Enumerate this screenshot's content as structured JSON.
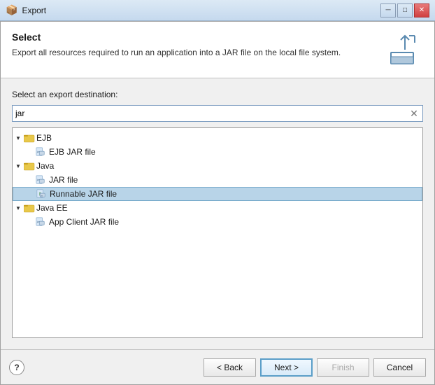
{
  "titlebar": {
    "title": "Export",
    "min_label": "─",
    "max_label": "□",
    "close_label": "✕"
  },
  "header": {
    "title": "Select",
    "description": "Export all resources required to run an application into a JAR file on the local file system.",
    "icon_label": "export-icon"
  },
  "content": {
    "label": "Select an export destination:",
    "search_value": "jar",
    "search_placeholder": "",
    "tree": [
      {
        "id": "ejb",
        "level": 0,
        "type": "folder",
        "label": "EJB",
        "expanded": true,
        "selected": false,
        "children": [
          {
            "id": "ejb-jar",
            "level": 1,
            "type": "file",
            "label": "EJB JAR file",
            "selected": false
          }
        ]
      },
      {
        "id": "java",
        "level": 0,
        "type": "folder",
        "label": "Java",
        "expanded": true,
        "selected": false,
        "children": [
          {
            "id": "jar-file",
            "level": 1,
            "type": "file",
            "label": "JAR file",
            "selected": false
          },
          {
            "id": "runnable-jar",
            "level": 1,
            "type": "file",
            "label": "Runnable JAR file",
            "selected": true
          }
        ]
      },
      {
        "id": "java-ee",
        "level": 0,
        "type": "folder",
        "label": "Java EE",
        "expanded": true,
        "selected": false,
        "children": [
          {
            "id": "app-client-jar",
            "level": 1,
            "type": "file",
            "label": "App Client JAR file",
            "selected": false
          }
        ]
      }
    ]
  },
  "buttons": {
    "help_label": "?",
    "back_label": "< Back",
    "next_label": "Next >",
    "finish_label": "Finish",
    "cancel_label": "Cancel"
  }
}
